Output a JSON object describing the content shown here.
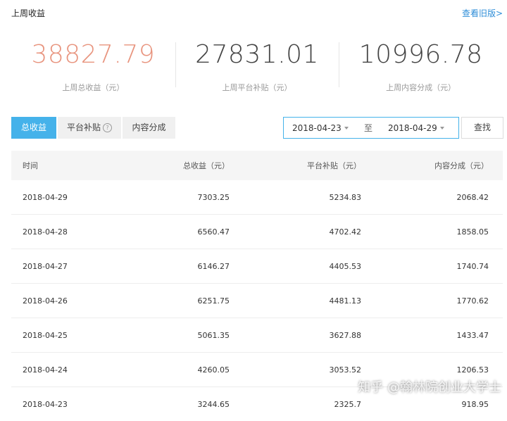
{
  "header": {
    "title": "上周收益",
    "old_version_link": "查看旧版>"
  },
  "stats": [
    {
      "value": "38827.79",
      "label": "上周总收益（元）",
      "highlight": true
    },
    {
      "value": "27831.01",
      "label": "上周平台补贴（元）"
    },
    {
      "value": "10996.78",
      "label": "上周内容分成（元）"
    }
  ],
  "tabs": [
    {
      "label": "总收益",
      "active": true
    },
    {
      "label": "平台补贴",
      "help_icon": "?"
    },
    {
      "label": "内容分成"
    }
  ],
  "filter": {
    "date_start": "2018-04-23",
    "separator": "至",
    "date_end": "2018-04-29",
    "search_label": "查找"
  },
  "table": {
    "columns": [
      "时间",
      "总收益（元）",
      "平台补贴（元）",
      "内容分成（元）"
    ],
    "rows": [
      [
        "2018-04-29",
        "7303.25",
        "5234.83",
        "2068.42"
      ],
      [
        "2018-04-28",
        "6560.47",
        "4702.42",
        "1858.05"
      ],
      [
        "2018-04-27",
        "6146.27",
        "4405.53",
        "1740.74"
      ],
      [
        "2018-04-26",
        "6251.75",
        "4481.13",
        "1770.62"
      ],
      [
        "2018-04-25",
        "5061.35",
        "3627.88",
        "1433.47"
      ],
      [
        "2018-04-24",
        "4260.05",
        "3053.52",
        "1206.53"
      ],
      [
        "2018-04-23",
        "3244.65",
        "2325.7",
        "918.95"
      ]
    ]
  },
  "watermark": "知乎 @翰林院创业大学士",
  "colors": {
    "accent": "#45b2ea",
    "highlight_value": "#e8947e",
    "link": "#2f8ed8"
  }
}
